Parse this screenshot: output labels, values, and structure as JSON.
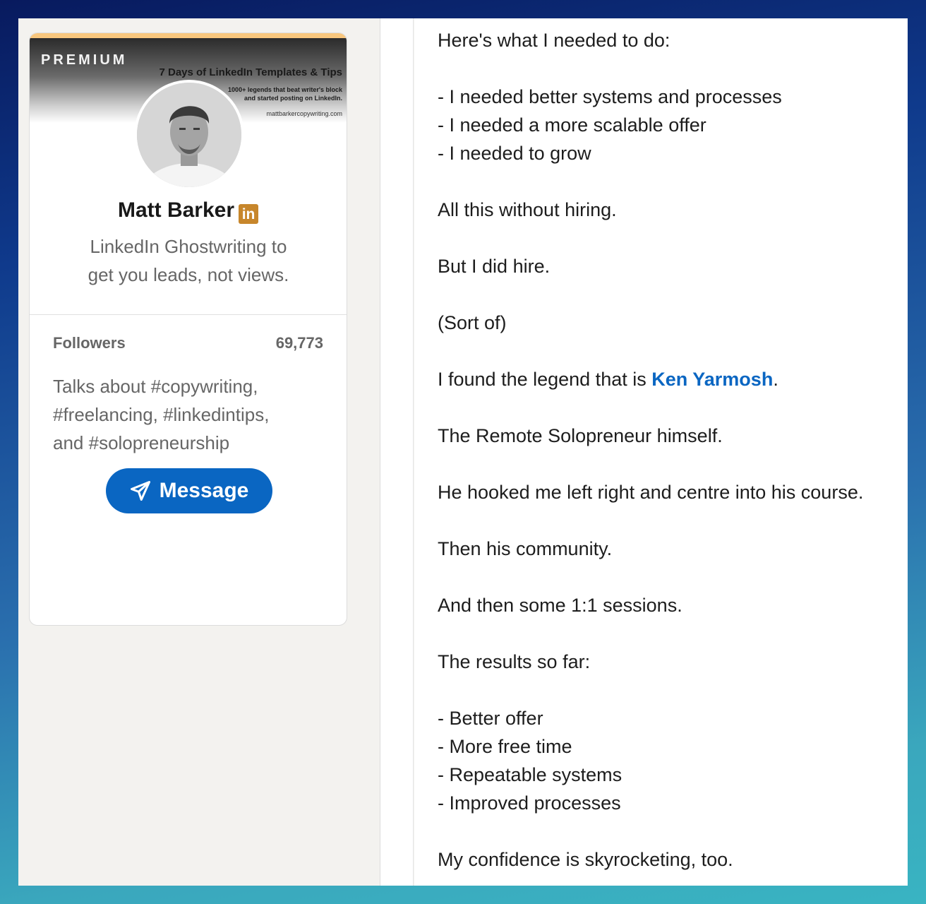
{
  "profile": {
    "premium_label": "PREMIUM",
    "banner_title": "7 Days of LinkedIn Templates & Tips",
    "banner_line1": "1000+ legends that beat writer's block",
    "banner_line2": "and started posting on LinkedIn.",
    "banner_url": "mattbarkercopywriting.com",
    "name": "Matt Barker",
    "badge_text": "in",
    "headline_line1": "LinkedIn Ghostwriting to",
    "headline_line2": "get you leads, not views.",
    "followers_label": "Followers",
    "followers_count": "69,773",
    "talks_line1": "Talks about #copywriting,",
    "talks_line2": "#freelancing, #linkedintips,",
    "talks_line3": "and #solopreneurship",
    "message_button": "Message"
  },
  "post": {
    "l1": "Here's what I needed to do:",
    "l2": "- I needed better systems and processes",
    "l3": "- I needed a more scalable offer",
    "l4": "- I needed to grow",
    "l5": "All this without hiring.",
    "l6": "But I did hire.",
    "l7": "(Sort of)",
    "l8_before": "I found the legend that is ",
    "l8_link": "Ken Yarmosh",
    "l8_after": ".",
    "l9": "The Remote Solopreneur himself.",
    "l10": "He hooked me left right and centre into his course.",
    "l11": "Then his community.",
    "l12": "And then some 1:1 sessions.",
    "l13": "The results so far:",
    "l14": "- Better offer",
    "l15": "- More free time",
    "l16": "- Repeatable systems",
    "l17": "- Improved processes",
    "l18": "My confidence is skyrocketing, too."
  },
  "colors": {
    "link": "#0a66c2",
    "button": "#0a66c2",
    "badge": "#c7862b",
    "premium_stripe": "#f8c77e"
  },
  "icons": {
    "badge": "linkedin-icon",
    "button": "paper-plane-icon"
  }
}
